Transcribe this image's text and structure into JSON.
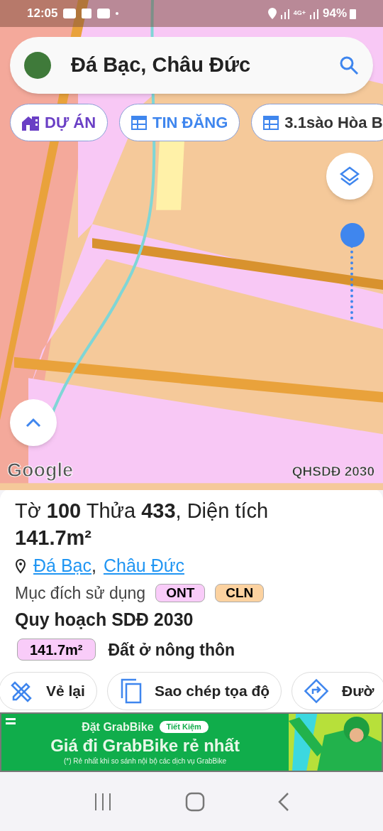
{
  "status_bar": {
    "time": "12:05",
    "network": "4G+",
    "battery": "94%"
  },
  "search": {
    "value": "Đá Bạc, Châu Đức"
  },
  "chips": [
    {
      "kind": "project",
      "label": "DỰ ÁN"
    },
    {
      "kind": "listing",
      "label": "TIN ĐĂNG"
    },
    {
      "kind": "item",
      "label": "3.1sào Hòa B"
    }
  ],
  "zoom_slider": {
    "level": 1
  },
  "map": {
    "attribution": "Google",
    "layer_label": "QHSDĐ 2030"
  },
  "parcel": {
    "title": "Tờ **100** Thửa **433**, Diện tích **141.7m²**",
    "location": [
      {
        "text": "Đá Bạc"
      },
      {
        "text": "Châu Đức"
      }
    ],
    "location_separator": ",",
    "purpose_label": "Mục đích sử dụng",
    "purpose_tags": [
      {
        "label": "ONT",
        "color": "#f9ccf9"
      },
      {
        "label": "CLN",
        "color": "#fcd2a0"
      }
    ],
    "plan_title": "Quy hoạch SDĐ 2030",
    "plan_rows": [
      {
        "area": "141.7m²",
        "color": "#f9ccf9",
        "name": "Đất ở nông thôn"
      }
    ]
  },
  "actions": [
    {
      "kind": "redraw",
      "label": "Vẻ lại"
    },
    {
      "kind": "copy",
      "label": "Sao chép tọa độ"
    },
    {
      "kind": "directions",
      "label": "Đườ"
    }
  ],
  "ad": {
    "headline": "Đặt GrabBike",
    "badge": "Tiết Kiệm",
    "title": "Giá đi GrabBike rẻ nhất",
    "footnote": "(*) Rẻ nhất khi so sánh nội bộ các dịch vụ GrabBike"
  }
}
